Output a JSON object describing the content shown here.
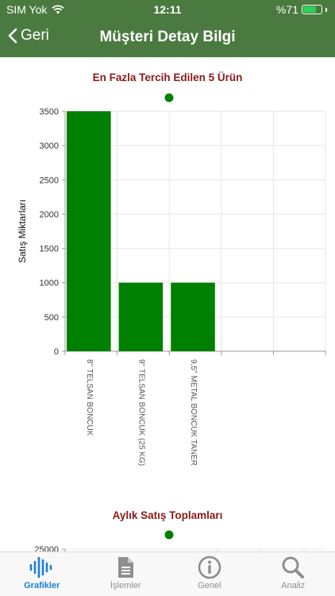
{
  "status_bar": {
    "carrier": "SIM Yok",
    "time": "12:11",
    "battery": "%71",
    "battery_level": 0.71
  },
  "nav": {
    "back_label": "Geri",
    "title": "Müşteri Detay Bilgi"
  },
  "charts": [
    {
      "title": "En Fazla Tercih Edilen 5 Ürün"
    },
    {
      "title": "Aylık Satış Toplamları"
    }
  ],
  "chart_data": [
    {
      "type": "bar",
      "title": "En Fazla Tercih Edilen 5 Ürün",
      "ylabel": "Satış Miktarları",
      "xlabel": "",
      "categories": [
        "8'' TELSAN BONCUK",
        "9'' TELSAN BONCUK (25 KG)",
        "9,5'' METAL BONCUK TANER",
        "",
        ""
      ],
      "values": [
        3500,
        1000,
        1000,
        null,
        null
      ],
      "ylim": [
        0,
        3500
      ],
      "yticks": [
        "0",
        "500",
        "1000",
        "1500",
        "2000",
        "2500",
        "3000",
        "3500"
      ],
      "series_color": "#008000",
      "grid": true
    },
    {
      "type": "line",
      "title": "Aylık Satış Toplamları",
      "yticks": [
        "25000"
      ],
      "series_color": "#008000",
      "grid": true
    }
  ],
  "tabs": [
    {
      "label": "Grafikler",
      "icon": "waveform-icon",
      "active": true
    },
    {
      "label": "İşlemler",
      "icon": "document-icon",
      "active": false
    },
    {
      "label": "Genel",
      "icon": "info-icon",
      "active": false
    },
    {
      "label": "Analiz",
      "icon": "search-icon",
      "active": false
    }
  ],
  "colors": {
    "header": "#4a7a3f",
    "title": "#8b1a1a",
    "bar": "#008000",
    "tab_active": "#1a7ed6",
    "tab_inactive": "#8e8e8e"
  }
}
